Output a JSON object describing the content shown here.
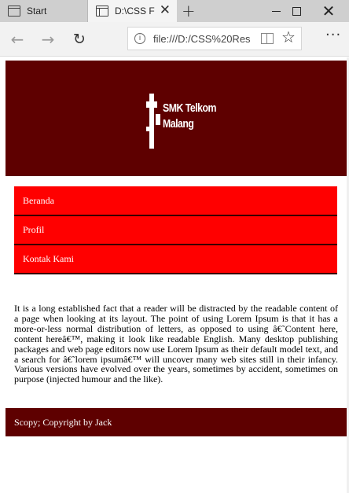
{
  "browser": {
    "tabs": [
      {
        "label": "Start"
      },
      {
        "label": "D:\\CSS F"
      }
    ],
    "new_tab_icon": "plus-icon",
    "address": "file:///D:/CSS%20Res",
    "icons": [
      "back-arrow-icon",
      "forward-arrow-icon",
      "refresh-icon",
      "info-icon",
      "reading-view-icon",
      "favorite-star-icon",
      "more-icon"
    ]
  },
  "page": {
    "header": {
      "bg_color": "#5e0000",
      "logo_line1": "SMK Telkom",
      "logo_line2": "Malang"
    },
    "menu": {
      "bg_color": "#ff0000",
      "items": [
        {
          "label": "Beranda"
        },
        {
          "label": "Profil"
        },
        {
          "label": "Kontak Kami"
        }
      ]
    },
    "article": "It is a long established fact that a reader will be distracted by the readable content of a page when looking at its layout. The point of using Lorem Ipsum is that it has a more-or-less normal distribution of letters, as opposed to using â€˜Content here, content hereâ€™, making it look like readable English. Many desktop publishing packages and web page editors now use Lorem Ipsum as their default model text, and a search for â€˜lorem ipsumâ€™ will uncover many web sites still in their infancy. Various versions have evolved over the years, sometimes by accident, sometimes on purpose (injected humour and the like).",
    "footer": "Scopy; Copyright by Jack"
  }
}
